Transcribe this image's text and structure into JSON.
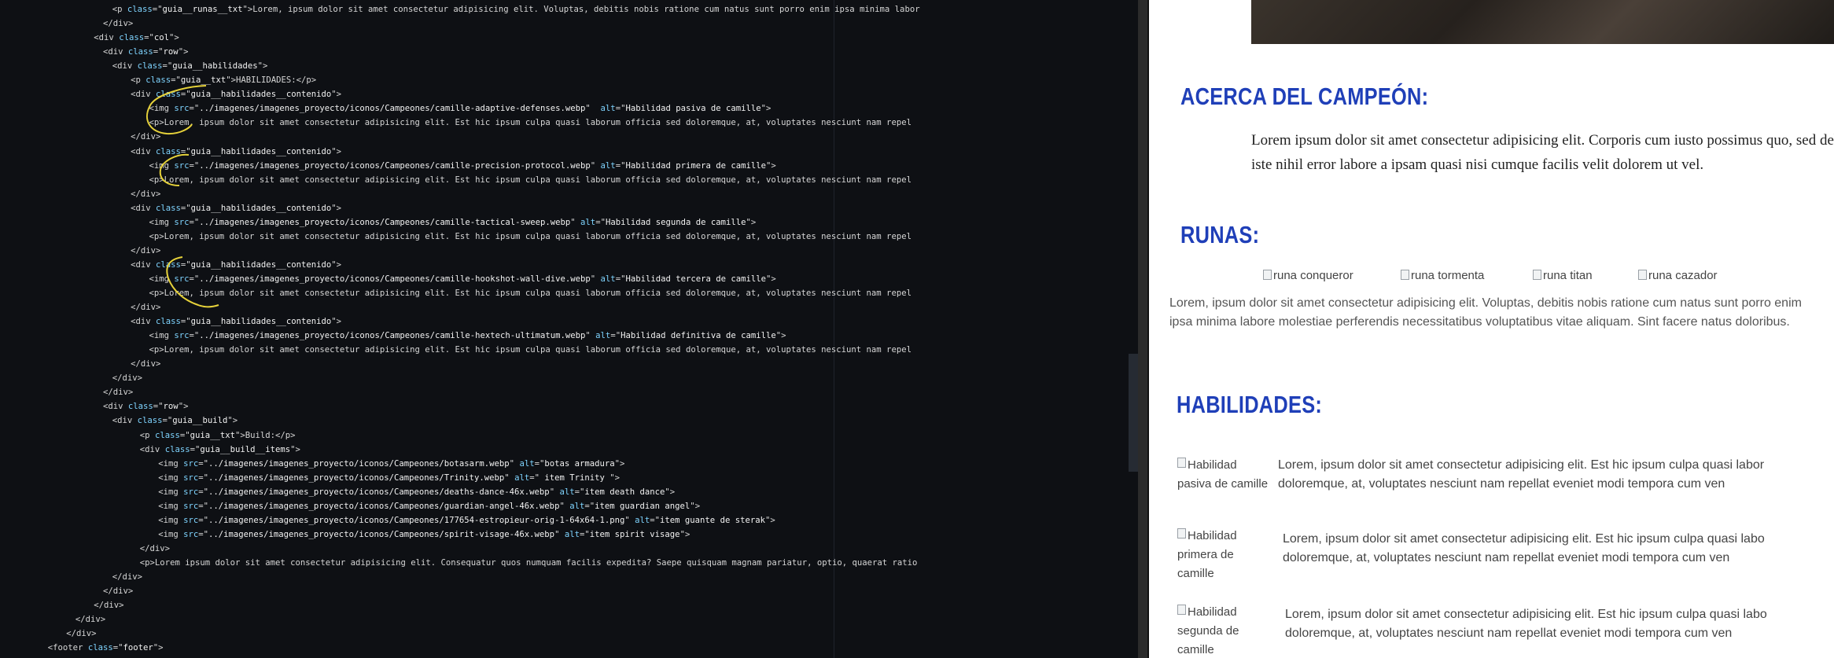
{
  "editor": {
    "lines": [
      {
        "indent": 11,
        "parts": [
          [
            "t",
            "<p "
          ],
          [
            "an",
            "class"
          ],
          [
            "t",
            "=\""
          ],
          [
            "av",
            "guia__runas__txt"
          ],
          [
            "t",
            "\">Lorem, ipsum dolor sit amet consectetur adipisicing elit. Voluptas, debitis nobis ratione cum natus sunt porro enim ipsa minima labor"
          ]
        ]
      },
      {
        "indent": 10,
        "parts": [
          [
            "t",
            "</div>"
          ]
        ]
      },
      {
        "indent": 9,
        "parts": [
          [
            "t",
            "<div "
          ],
          [
            "an",
            "class"
          ],
          [
            "t",
            "=\""
          ],
          [
            "av",
            "col"
          ],
          [
            "t",
            "\">"
          ]
        ]
      },
      {
        "indent": 10,
        "parts": [
          [
            "t",
            "<div "
          ],
          [
            "an",
            "class"
          ],
          [
            "t",
            "=\""
          ],
          [
            "av",
            "row"
          ],
          [
            "t",
            "\">"
          ]
        ]
      },
      {
        "indent": 11,
        "parts": [
          [
            "t",
            "<div "
          ],
          [
            "an",
            "class"
          ],
          [
            "t",
            "=\""
          ],
          [
            "av",
            "guia__habilidades"
          ],
          [
            "t",
            "\">"
          ]
        ]
      },
      {
        "indent": 13,
        "parts": [
          [
            "t",
            "<p "
          ],
          [
            "an",
            "class"
          ],
          [
            "t",
            "=\""
          ],
          [
            "av",
            "guia__txt"
          ],
          [
            "t",
            "\">HABILIDADES:</p>"
          ]
        ]
      },
      {
        "indent": 13,
        "parts": [
          [
            "t",
            "<div "
          ],
          [
            "an",
            "class"
          ],
          [
            "t",
            "=\""
          ],
          [
            "av",
            "guia__habilidades__contenido"
          ],
          [
            "t",
            "\">"
          ]
        ]
      },
      {
        "indent": 15,
        "parts": [
          [
            "t",
            "<img "
          ],
          [
            "an",
            "src"
          ],
          [
            "t",
            "=\""
          ],
          [
            "av",
            "../imagenes/imagenes_proyecto/iconos/Campeones/camille-adaptive-defenses.webp"
          ],
          [
            "t",
            "\"  "
          ],
          [
            "an",
            "alt"
          ],
          [
            "t",
            "=\""
          ],
          [
            "av",
            "Habilidad pasiva de camille"
          ],
          [
            "t",
            "\">"
          ]
        ]
      },
      {
        "indent": 15,
        "parts": [
          [
            "t",
            "<p>Lorem, ipsum dolor sit amet consectetur adipisicing elit. Est hic ipsum culpa quasi laborum officia sed doloremque, at, voluptates nesciunt nam repel"
          ]
        ]
      },
      {
        "indent": 13,
        "parts": [
          [
            "t",
            "</div>"
          ]
        ]
      },
      {
        "indent": 13,
        "parts": [
          [
            "t",
            "<div "
          ],
          [
            "an",
            "class"
          ],
          [
            "t",
            "=\""
          ],
          [
            "av",
            "guia__habilidades__contenido"
          ],
          [
            "t",
            "\">"
          ]
        ]
      },
      {
        "indent": 15,
        "parts": [
          [
            "t",
            "<img "
          ],
          [
            "an",
            "src"
          ],
          [
            "t",
            "=\""
          ],
          [
            "av",
            "../imagenes/imagenes_proyecto/iconos/Campeones/camille-precision-protocol.webp"
          ],
          [
            "t",
            "\" "
          ],
          [
            "an",
            "alt"
          ],
          [
            "t",
            "=\""
          ],
          [
            "av",
            "Habilidad primera de camille"
          ],
          [
            "t",
            "\">"
          ]
        ]
      },
      {
        "indent": 15,
        "parts": [
          [
            "t",
            "<p>Lorem, ipsum dolor sit amet consectetur adipisicing elit. Est hic ipsum culpa quasi laborum officia sed doloremque, at, voluptates nesciunt nam repel"
          ]
        ]
      },
      {
        "indent": 13,
        "parts": [
          [
            "t",
            "</div>"
          ]
        ]
      },
      {
        "indent": 13,
        "parts": [
          [
            "t",
            "<div "
          ],
          [
            "an",
            "class"
          ],
          [
            "t",
            "=\""
          ],
          [
            "av",
            "guia__habilidades__contenido"
          ],
          [
            "t",
            "\">"
          ]
        ]
      },
      {
        "indent": 15,
        "parts": [
          [
            "t",
            "<img "
          ],
          [
            "an",
            "src"
          ],
          [
            "t",
            "=\""
          ],
          [
            "av",
            "../imagenes/imagenes_proyecto/iconos/Campeones/camille-tactical-sweep.webp"
          ],
          [
            "t",
            "\" "
          ],
          [
            "an",
            "alt"
          ],
          [
            "t",
            "=\""
          ],
          [
            "av",
            "Habilidad segunda de camille"
          ],
          [
            "t",
            "\">"
          ]
        ]
      },
      {
        "indent": 15,
        "parts": [
          [
            "t",
            "<p>Lorem, ipsum dolor sit amet consectetur adipisicing elit. Est hic ipsum culpa quasi laborum officia sed doloremque, at, voluptates nesciunt nam repel"
          ]
        ]
      },
      {
        "indent": 13,
        "parts": [
          [
            "t",
            "</div>"
          ]
        ]
      },
      {
        "indent": 13,
        "parts": [
          [
            "t",
            "<div "
          ],
          [
            "an",
            "class"
          ],
          [
            "t",
            "=\""
          ],
          [
            "av",
            "guia__habilidades__contenido"
          ],
          [
            "t",
            "\">"
          ]
        ]
      },
      {
        "indent": 15,
        "parts": [
          [
            "t",
            "<img "
          ],
          [
            "an",
            "src"
          ],
          [
            "t",
            "=\""
          ],
          [
            "av",
            "../imagenes/imagenes_proyecto/iconos/Campeones/camille-hookshot-wall-dive.webp"
          ],
          [
            "t",
            "\" "
          ],
          [
            "an",
            "alt"
          ],
          [
            "t",
            "=\""
          ],
          [
            "av",
            "Habilidad tercera de camille"
          ],
          [
            "t",
            "\">"
          ]
        ]
      },
      {
        "indent": 15,
        "parts": [
          [
            "t",
            "<p>Lorem, ipsum dolor sit amet consectetur adipisicing elit. Est hic ipsum culpa quasi laborum officia sed doloremque, at, voluptates nesciunt nam repel"
          ]
        ]
      },
      {
        "indent": 13,
        "parts": [
          [
            "t",
            "</div>"
          ]
        ]
      },
      {
        "indent": 13,
        "parts": [
          [
            "t",
            "<div "
          ],
          [
            "an",
            "class"
          ],
          [
            "t",
            "=\""
          ],
          [
            "av",
            "guia__habilidades__contenido"
          ],
          [
            "t",
            "\">"
          ]
        ]
      },
      {
        "indent": 15,
        "parts": [
          [
            "t",
            "<img "
          ],
          [
            "an",
            "src"
          ],
          [
            "t",
            "=\""
          ],
          [
            "av",
            "../imagenes/imagenes_proyecto/iconos/Campeones/camille-hextech-ultimatum.webp"
          ],
          [
            "t",
            "\" "
          ],
          [
            "an",
            "alt"
          ],
          [
            "t",
            "=\""
          ],
          [
            "av",
            "Habilidad definitiva de camille"
          ],
          [
            "t",
            "\">"
          ]
        ]
      },
      {
        "indent": 15,
        "parts": [
          [
            "t",
            "<p>Lorem, ipsum dolor sit amet consectetur adipisicing elit. Est hic ipsum culpa quasi laborum officia sed doloremque, at, voluptates nesciunt nam repel"
          ]
        ]
      },
      {
        "indent": 13,
        "parts": [
          [
            "t",
            "</div>"
          ]
        ]
      },
      {
        "indent": 11,
        "parts": [
          [
            "t",
            "</div>"
          ]
        ]
      },
      {
        "indent": 10,
        "parts": [
          [
            "t",
            "</div>"
          ]
        ]
      },
      {
        "indent": 10,
        "parts": [
          [
            "t",
            "<div "
          ],
          [
            "an",
            "class"
          ],
          [
            "t",
            "=\""
          ],
          [
            "av",
            "row"
          ],
          [
            "t",
            "\">"
          ]
        ]
      },
      {
        "indent": 11,
        "parts": [
          [
            "t",
            "<div "
          ],
          [
            "an",
            "class"
          ],
          [
            "t",
            "=\""
          ],
          [
            "av",
            "guia__build"
          ],
          [
            "t",
            "\">"
          ]
        ]
      },
      {
        "indent": 14,
        "parts": [
          [
            "t",
            "<p "
          ],
          [
            "an",
            "class"
          ],
          [
            "t",
            "=\""
          ],
          [
            "av",
            "guia__txt"
          ],
          [
            "t",
            "\">Build:</p>"
          ]
        ]
      },
      {
        "indent": 14,
        "parts": [
          [
            "t",
            "<div "
          ],
          [
            "an",
            "class"
          ],
          [
            "t",
            "=\""
          ],
          [
            "av",
            "guia__build__items"
          ],
          [
            "t",
            "\">"
          ]
        ]
      },
      {
        "indent": 16,
        "parts": [
          [
            "t",
            "<img "
          ],
          [
            "an",
            "src"
          ],
          [
            "t",
            "=\""
          ],
          [
            "av",
            "../imagenes/imagenes_proyecto/iconos/Campeones/botasarm.webp"
          ],
          [
            "t",
            "\" "
          ],
          [
            "an",
            "alt"
          ],
          [
            "t",
            "=\""
          ],
          [
            "av",
            "botas armadura"
          ],
          [
            "t",
            "\">"
          ]
        ]
      },
      {
        "indent": 16,
        "parts": [
          [
            "t",
            "<img "
          ],
          [
            "an",
            "src"
          ],
          [
            "t",
            "=\""
          ],
          [
            "av",
            "../imagenes/imagenes_proyecto/iconos/Campeones/Trinity.webp"
          ],
          [
            "t",
            "\" "
          ],
          [
            "an",
            "alt"
          ],
          [
            "t",
            "=\""
          ],
          [
            "av",
            " item Trinity "
          ],
          [
            "t",
            "\">"
          ]
        ]
      },
      {
        "indent": 16,
        "parts": [
          [
            "t",
            "<img "
          ],
          [
            "an",
            "src"
          ],
          [
            "t",
            "=\""
          ],
          [
            "av",
            "../imagenes/imagenes_proyecto/iconos/Campeones/deaths-dance-46x.webp"
          ],
          [
            "t",
            "\" "
          ],
          [
            "an",
            "alt"
          ],
          [
            "t",
            "=\""
          ],
          [
            "av",
            "item death dance"
          ],
          [
            "t",
            "\">"
          ]
        ]
      },
      {
        "indent": 16,
        "parts": [
          [
            "t",
            "<img "
          ],
          [
            "an",
            "src"
          ],
          [
            "t",
            "=\""
          ],
          [
            "av",
            "../imagenes/imagenes_proyecto/iconos/Campeones/guardian-angel-46x.webp"
          ],
          [
            "t",
            "\" "
          ],
          [
            "an",
            "alt"
          ],
          [
            "t",
            "=\""
          ],
          [
            "av",
            "item guardian angel"
          ],
          [
            "t",
            "\">"
          ]
        ]
      },
      {
        "indent": 16,
        "parts": [
          [
            "t",
            "<img "
          ],
          [
            "an",
            "src"
          ],
          [
            "t",
            "=\""
          ],
          [
            "av",
            "../imagenes/imagenes_proyecto/iconos/Campeones/177654-estropieur-orig-1-64x64-1.png"
          ],
          [
            "t",
            "\" "
          ],
          [
            "an",
            "alt"
          ],
          [
            "t",
            "=\""
          ],
          [
            "av",
            "item guante de sterak"
          ],
          [
            "t",
            "\">"
          ]
        ]
      },
      {
        "indent": 16,
        "parts": [
          [
            "t",
            "<img "
          ],
          [
            "an",
            "src"
          ],
          [
            "t",
            "=\""
          ],
          [
            "av",
            "../imagenes/imagenes_proyecto/iconos/Campeones/spirit-visage-46x.webp"
          ],
          [
            "t",
            "\" "
          ],
          [
            "an",
            "alt"
          ],
          [
            "t",
            "=\""
          ],
          [
            "av",
            "item spirit visage"
          ],
          [
            "t",
            "\">"
          ]
        ]
      },
      {
        "indent": 14,
        "parts": [
          [
            "t",
            "</div>"
          ]
        ]
      },
      {
        "indent": 14,
        "parts": [
          [
            "t",
            "<p>Lorem ipsum dolor sit amet consectetur adipisicing elit. Consequatur quos numquam facilis expedita? Saepe quisquam magnam pariatur, optio, quaerat ratio"
          ]
        ]
      },
      {
        "indent": 11,
        "parts": [
          [
            "t",
            "</div>"
          ]
        ]
      },
      {
        "indent": 10,
        "parts": [
          [
            "t",
            "</div>"
          ]
        ]
      },
      {
        "indent": 9,
        "parts": [
          [
            "t",
            "</div>"
          ]
        ]
      },
      {
        "indent": 7,
        "parts": [
          [
            "t",
            "</div>"
          ]
        ]
      },
      {
        "indent": 6,
        "parts": [
          [
            "t",
            "</div>"
          ]
        ]
      },
      {
        "indent": 4,
        "parts": [
          [
            "t",
            "<footer "
          ],
          [
            "an",
            "class"
          ],
          [
            "t",
            "=\""
          ],
          [
            "av",
            "footer"
          ],
          [
            "t",
            "\">"
          ]
        ]
      }
    ]
  },
  "preview": {
    "about_heading": "ACERCA DEL CAMPEÓN:",
    "about_text": "Lorem ipsum dolor sit amet consectetur adipisicing elit. Corporis cum iusto possimus quo, sed debi iste nihil error labore a ipsam quasi nisi cumque facilis velit dolorem ut vel.",
    "runas_heading": "RUNAS:",
    "runes": [
      "runa conqueror",
      "runa tormenta",
      "runa titan",
      "runa cazador"
    ],
    "runas_text": "Lorem, ipsum dolor sit amet consectetur adipisicing elit. Voluptas, debitis nobis ratione cum natus sunt porro enim ipsa minima labore molestiae perferendis necessitatibus voluptatibus vitae aliquam. Sint facere natus doloribus.",
    "habilidades_heading": "HABILIDADES:",
    "skills": [
      {
        "img_alt_lines": [
          "Habilidad",
          "pasiva de camille"
        ],
        "desc_lines": [
          "Lorem, ipsum dolor sit amet consectetur adipisicing elit. Est hic ipsum culpa quasi labor",
          "doloremque, at, voluptates nesciunt nam repellat eveniet modi tempora cum ven"
        ]
      },
      {
        "img_alt_lines": [
          "Habilidad",
          "primera de",
          "camille"
        ],
        "desc_lines": [
          "Lorem, ipsum dolor sit amet consectetur adipisicing elit. Est hic ipsum culpa quasi labo",
          "doloremque, at, voluptates nesciunt nam repellat eveniet modi tempora cum ven"
        ]
      },
      {
        "img_alt_lines": [
          "Habilidad",
          "segunda de",
          "camille"
        ],
        "desc_lines": [
          "Lorem, ipsum dolor sit amet consectetur adipisicing elit. Est hic ipsum culpa quasi labo",
          "doloremque, at, voluptates nesciunt nam repellat eveniet modi tempora cum ven"
        ]
      }
    ]
  },
  "colors": {
    "heading": "#1f3fb8",
    "annotation": "#e6d23a",
    "attr_name": "#7fd4ff"
  }
}
